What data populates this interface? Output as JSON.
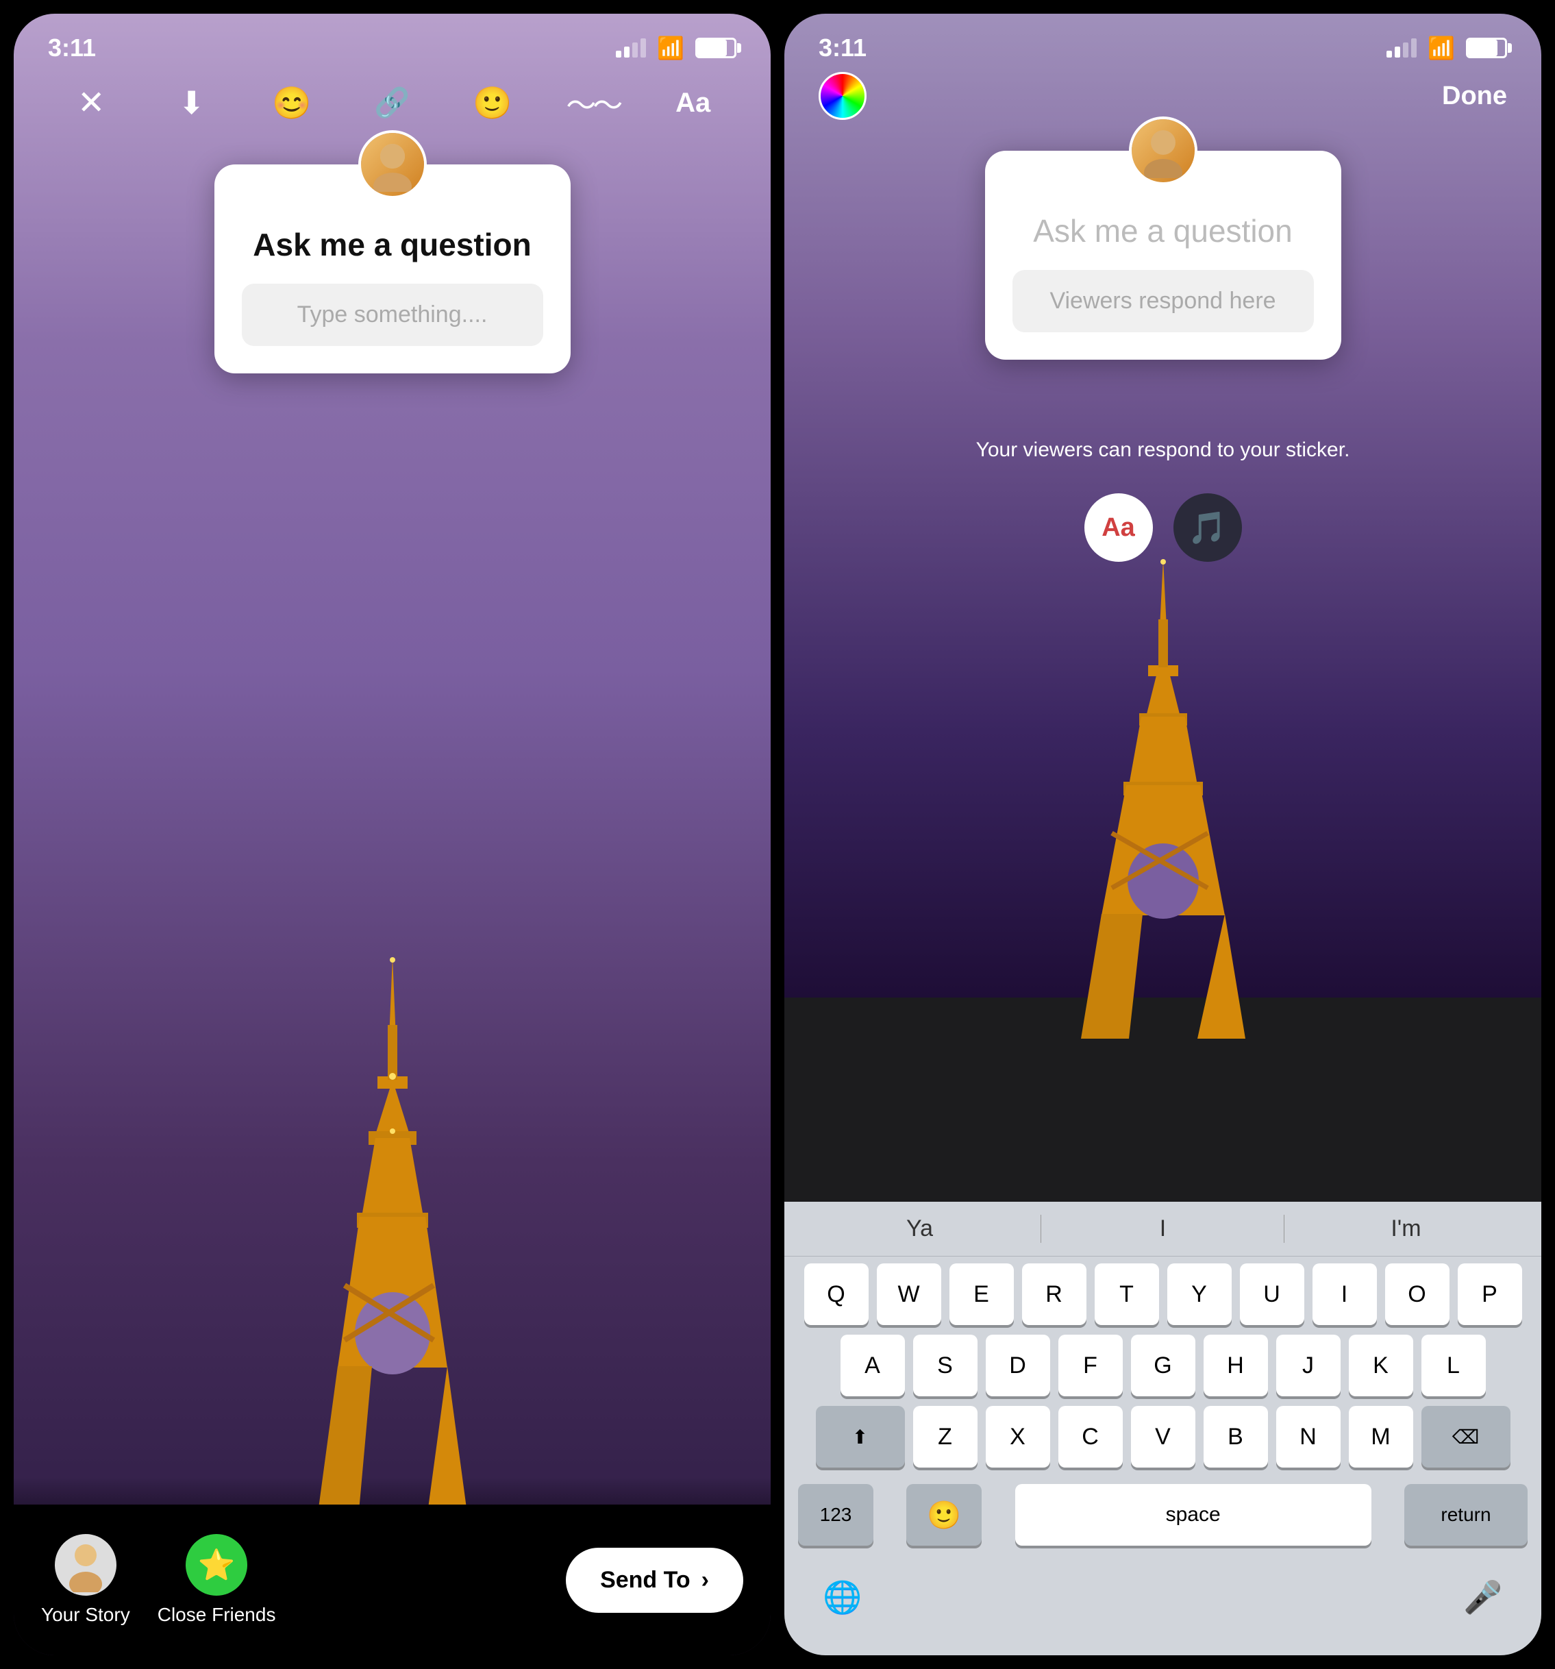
{
  "screen1": {
    "status_time": "3:11",
    "toolbar": {
      "close": "✕",
      "download": "⬇",
      "emoji_plus": "☺",
      "link": "🔗",
      "sticker": "☺",
      "draw": "〜",
      "text": "Aa"
    },
    "question_card": {
      "title": "Ask me a question",
      "input_placeholder": "Type something...."
    },
    "bottom": {
      "your_story_label": "Your Story",
      "close_friends_label": "Close Friends",
      "send_btn": "Send To"
    }
  },
  "screen2": {
    "status_time": "3:11",
    "done_btn": "Done",
    "question_card": {
      "title": "Ask me a question",
      "input_placeholder": "Viewers respond here"
    },
    "viewer_info": "Your viewers can respond to your sticker.",
    "sticker_tools": {
      "text": "Aa",
      "music": "♪"
    },
    "autocomplete": {
      "word1": "Ya",
      "word2": "I",
      "word3": "I'm"
    },
    "keyboard": {
      "row1": [
        "Q",
        "W",
        "E",
        "R",
        "T",
        "Y",
        "U",
        "I",
        "O",
        "P"
      ],
      "row2": [
        "A",
        "S",
        "D",
        "F",
        "G",
        "H",
        "J",
        "K",
        "L"
      ],
      "row3": [
        "Z",
        "X",
        "C",
        "V",
        "B",
        "N",
        "M"
      ],
      "shift": "⬆",
      "delete": "⌫",
      "num": "123",
      "emoji": "☺",
      "space": "space",
      "return": "return"
    }
  }
}
